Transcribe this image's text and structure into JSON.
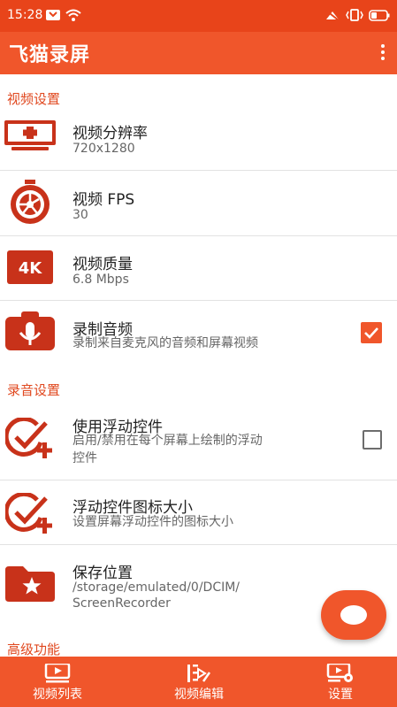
{
  "status_bar": {
    "time": "15:28",
    "icons": [
      "mail-icon",
      "wifi-icon",
      "mute-icon",
      "vibrate-icon",
      "battery-icon"
    ]
  },
  "app_bar": {
    "title": "飞猫录屏",
    "menu_icon": "more-vertical-icon"
  },
  "sections": {
    "video": "视频设置",
    "audio": "录音设置",
    "advanced": "高级功能"
  },
  "settings": {
    "resolution": {
      "title": "视频分辨率",
      "subtitle": "720x1280",
      "icon": "screen-plus-icon"
    },
    "fps": {
      "title": "视频 FPS",
      "subtitle": "30",
      "icon": "stopwatch-icon"
    },
    "quality": {
      "title": "视频质量",
      "subtitle": "6.8 Mbps",
      "icon": "4k-icon"
    },
    "record_audio": {
      "title": "录制音频",
      "subtitle": "录制来自麦克风的音频和屏幕视频",
      "icon": "microphone-icon",
      "checked": true
    },
    "floating_control": {
      "title": "使用浮动控件",
      "subtitle_line1": "启用/禁用在每个屏幕上绘制的浮动",
      "subtitle_line2": "控件",
      "icon": "check-plus-icon",
      "checked": false
    },
    "floating_icon_size": {
      "title": "浮动控件图标大小",
      "subtitle": "设置屏幕浮动控件的图标大小",
      "icon": "check-plus-icon"
    },
    "save_location": {
      "title": "保存位置",
      "subtitle_line1": "/storage/emulated/0/DCIM/",
      "subtitle_line2": "ScreenRecorder",
      "icon": "folder-star-icon"
    }
  },
  "bottom_nav": [
    {
      "label": "视频列表",
      "icon": "video-list-icon"
    },
    {
      "label": "视频编辑",
      "icon": "video-edit-icon"
    },
    {
      "label": "设置",
      "icon": "settings-icon"
    }
  ],
  "colors": {
    "accent": "#f0562b",
    "status_bar": "#e8441a",
    "icon_red": "#c8321a"
  }
}
